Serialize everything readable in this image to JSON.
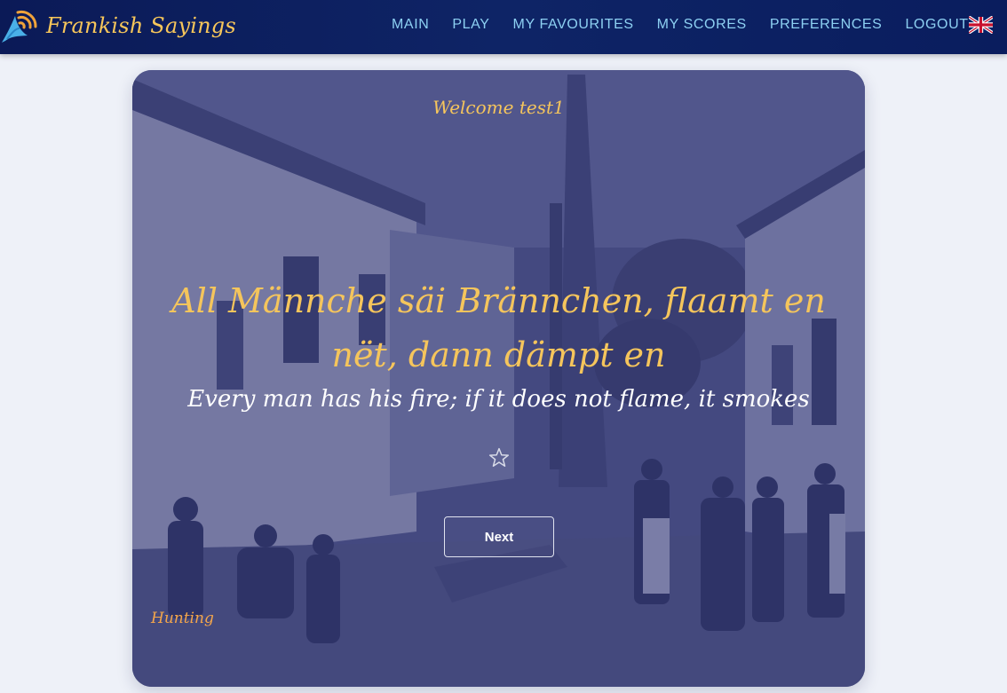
{
  "app": {
    "title": "Frankish Sayings",
    "logo_icon": "bird-soundwave-icon"
  },
  "nav": {
    "items": [
      {
        "label": "MAIN"
      },
      {
        "label": "PLAY"
      },
      {
        "label": "MY FAVOURITES"
      },
      {
        "label": "MY SCORES"
      },
      {
        "label": "PREFERENCES"
      },
      {
        "label": "LOGOUT"
      }
    ],
    "language_icon": "uk-flag-icon"
  },
  "card": {
    "welcome": "Welcome test1",
    "saying": "All Männche säi Brännchen, flaamt en nët, dann dämpt en",
    "translation": "Every man has his fire; if it does not flame, it smokes",
    "favourite_icon": "star-outline-icon",
    "next_label": "Next",
    "category": "Hunting",
    "background": "historic-village-street-photo"
  },
  "colors": {
    "navbar": "#0b1a57",
    "brand": "#f7c65a",
    "nav_link": "#8dd0f2",
    "accent": "#f5c55c",
    "category": "#f5a64a",
    "card_tint": "#2f3476",
    "page_bg": "#eef1f8"
  }
}
